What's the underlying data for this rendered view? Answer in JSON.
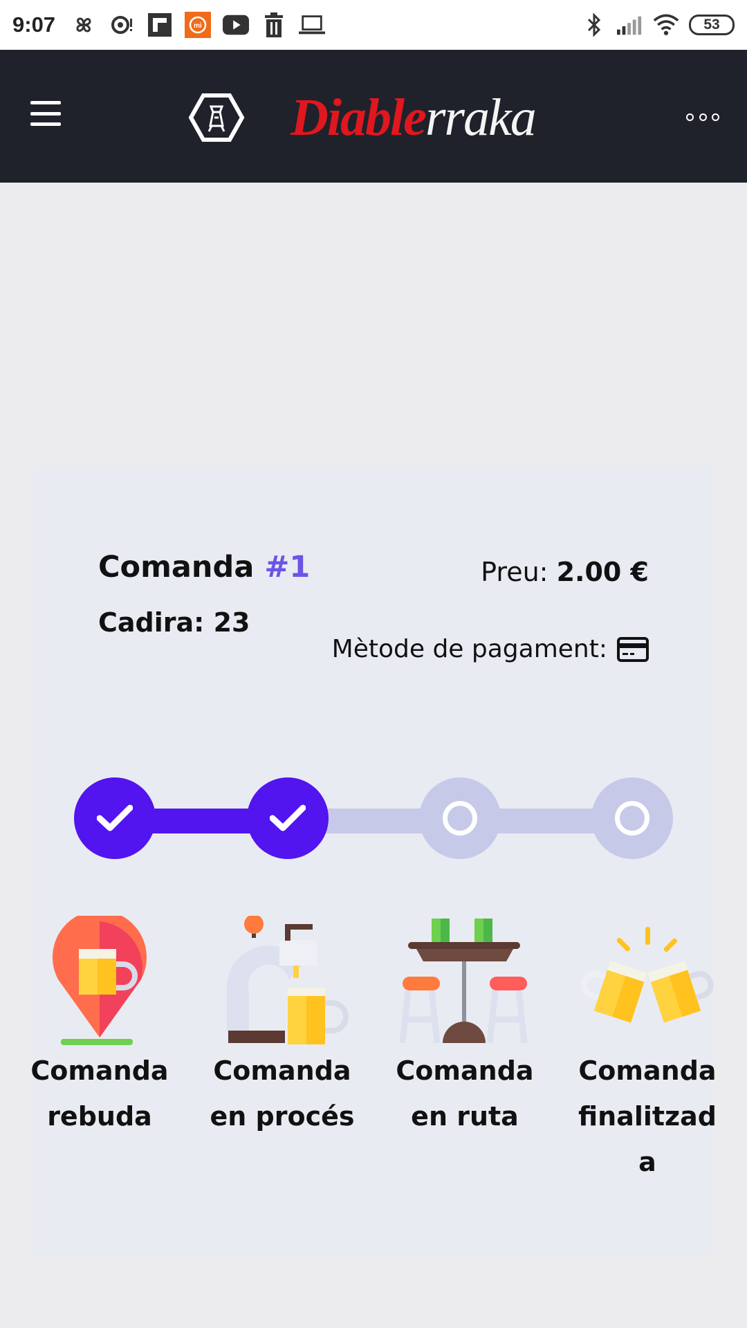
{
  "status_bar": {
    "time": "9:07",
    "battery": "53",
    "left_icons": [
      "pinwheel-icon",
      "chat-bubble-icon",
      "flipboard-icon",
      "mi-icon",
      "youtube-icon",
      "trash-icon",
      "laptop-icon"
    ],
    "right_icons": [
      "bluetooth-icon",
      "cell-signal-icon",
      "wifi-icon",
      "battery-icon"
    ]
  },
  "header": {
    "brand_red": "Diable",
    "brand_white": "rraka"
  },
  "order": {
    "label": "Comanda",
    "number": "#1",
    "chair_label": "Cadira:",
    "chair_value": "23",
    "price_label": "Preu:",
    "price_value": "2.00 €",
    "payment_label": "Mètode de pagament:",
    "payment_icon": "credit-card-icon"
  },
  "progress": {
    "completed_steps": 2,
    "total_steps": 4,
    "colors": {
      "done": "#5214ef",
      "todo": "#c7c9e9",
      "accent": "#6c54e6"
    }
  },
  "stages": [
    {
      "line1": "Comanda",
      "line2": "rebuda",
      "line3": "",
      "icon": "beer-location-pin-icon"
    },
    {
      "line1": "Comanda",
      "line2": "en procés",
      "line3": "",
      "icon": "beer-tap-icon"
    },
    {
      "line1": "Comanda",
      "line2": "en ruta",
      "line3": "",
      "icon": "bar-table-stools-icon"
    },
    {
      "line1": "Comanda",
      "line2": "finalitzad",
      "line3": "a",
      "icon": "cheers-beers-icon"
    }
  ]
}
